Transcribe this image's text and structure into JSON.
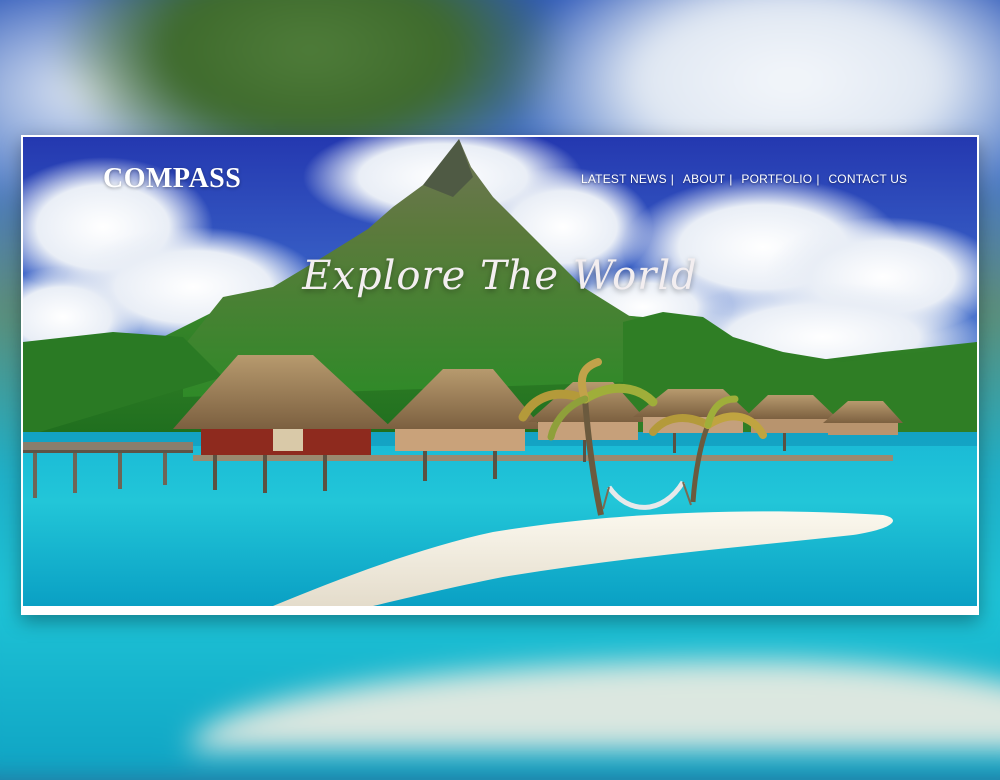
{
  "site": {
    "logo": "COMPASS",
    "tagline": "Explore The World"
  },
  "nav": {
    "items": [
      {
        "label": "LATEST NEWS",
        "separator": "|"
      },
      {
        "label": "ABOUT",
        "separator": "|"
      },
      {
        "label": "PORTFOLIO",
        "separator": "|"
      },
      {
        "label": "CONTACT US",
        "separator": ""
      }
    ]
  },
  "colors": {
    "sky": "#2d4fc0",
    "lagoon": "#1ec0d4",
    "island": "#3f8a2e",
    "text": "#ffffff"
  }
}
